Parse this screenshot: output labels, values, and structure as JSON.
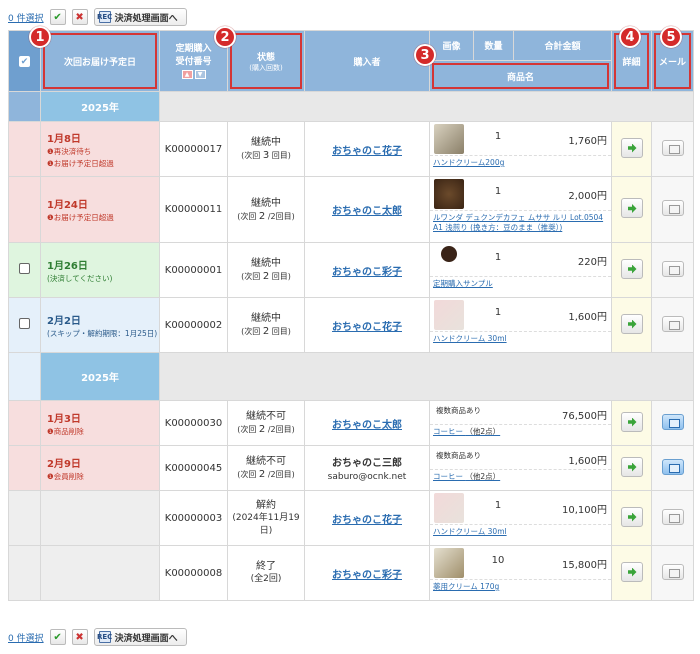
{
  "toolbar": {
    "selected": "0 件選択",
    "check_all": "✔",
    "uncheck_all": "✖",
    "process_button": "決済処理画面へ",
    "process_icon": "REC"
  },
  "header": {
    "next_delivery": "次回お届け予定日",
    "subscription_no": "定期購入受付番号",
    "status": "状態",
    "status_sub": "(購入回数)",
    "buyer": "購入者",
    "image": "画像",
    "qty": "数量",
    "total": "合計金額",
    "product_name": "商品名",
    "detail": "詳細",
    "mail": "メール",
    "sort_up": "▲",
    "sort_down": "▼"
  },
  "badges": [
    "1",
    "2",
    "3",
    "4",
    "5"
  ],
  "year_groups": [
    {
      "year": "2025年",
      "rows": [
        {
          "date": "1月8日",
          "notes": [
            "❶再決済待ち",
            "❶お届け予定日超過"
          ],
          "order": "K00000017",
          "status": "継続中",
          "count_pre": "(次回",
          "count": "3",
          "count_post": "回目)",
          "buyer": "おちゃのこ花子",
          "qty": "1",
          "price": "1,760円",
          "product": "ハンドクリーム200g",
          "mail_on": false
        },
        {
          "date": "1月24日",
          "notes": [
            "❶お届け予定日超過"
          ],
          "order": "K00000011",
          "status": "継続中",
          "count_pre": "(次回",
          "count": "2",
          "count_post": "/2回目)",
          "buyer": "おちゃのこ太郎",
          "qty": "1",
          "price": "2,000円",
          "product": "ルワンダ デュクンデカフェ ムササ ルリ Lot.0504 A1 浅煎り (挽き方：豆のまま（推奨）)",
          "mail_on": false
        },
        {
          "date": "1月26日",
          "notes": [
            "(決済してください)"
          ],
          "order": "K00000001",
          "status": "継続中",
          "count_pre": "(次回",
          "count": "2",
          "count_post": "回目)",
          "buyer": "おちゃのこ彩子",
          "qty": "1",
          "price": "220円",
          "product": "定期購入サンプル",
          "mail_on": false
        },
        {
          "date": "2月2日",
          "notes": [
            "(スキップ・解約期限：1月25日)"
          ],
          "order": "K00000002",
          "status": "継続中",
          "count_pre": "(次回",
          "count": "2",
          "count_post": "回目)",
          "buyer": "おちゃのこ花子",
          "qty": "1",
          "price": "1,600円",
          "product": "ハンドクリーム 30ml",
          "mail_on": false
        }
      ]
    },
    {
      "year": "2025年",
      "rows": [
        {
          "date": "1月3日",
          "notes": [
            "❶商品削除"
          ],
          "order": "K00000030",
          "status": "継続不可",
          "count_pre": "(次回",
          "count": "2",
          "count_post": "/2回目)",
          "buyer": "おちゃのこ太郎",
          "multi": "複数商品あり",
          "price": "76,500円",
          "product": "コーヒー",
          "other": "（他2点）",
          "mail_on": true
        },
        {
          "date": "2月9日",
          "notes": [
            "❶会員削除"
          ],
          "order": "K00000045",
          "status": "継続不可",
          "count_pre": "(次回",
          "count": "2",
          "count_post": "/2回目)",
          "buyer": "おちゃのこ三郎",
          "email": "saburo@ocnk.net",
          "multi": "複数商品あり",
          "price": "1,600円",
          "product": "コーヒー",
          "other": "（他2点）",
          "mail_on": true
        },
        {
          "date": "",
          "notes": [],
          "order": "K00000003",
          "status": "解約",
          "sub": "(2024年11月19日)",
          "buyer": "おちゃのこ花子",
          "qty": "1",
          "price": "10,100円",
          "product": "ハンドクリーム 30ml",
          "mail_on": false
        },
        {
          "date": "",
          "notes": [],
          "order": "K00000008",
          "status": "終了",
          "sub": "(全2回)",
          "buyer": "おちゃのこ彩子",
          "qty": "10",
          "price": "15,800円",
          "product": "薬用クリーム 170g",
          "mail_on": false
        }
      ]
    }
  ]
}
